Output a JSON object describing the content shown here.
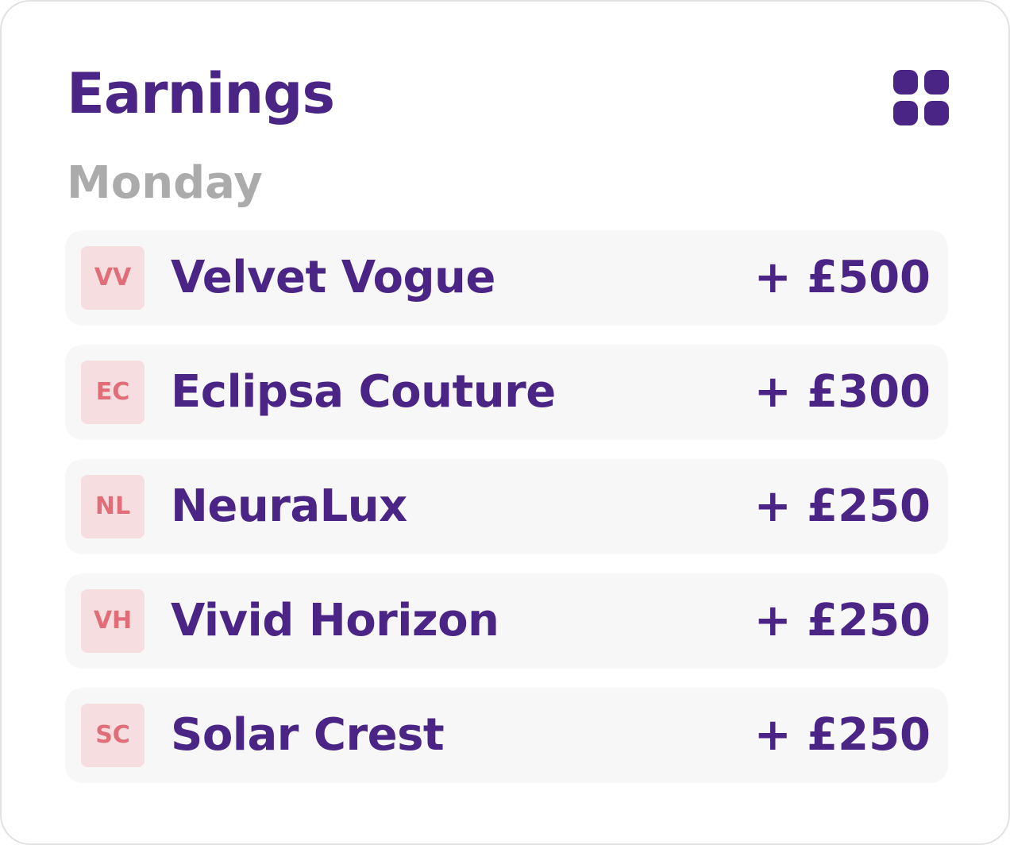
{
  "header": {
    "title": "Earnings",
    "menu_icon": "grid-icon"
  },
  "section": {
    "day_label": "Monday"
  },
  "earnings": [
    {
      "initials": "VV",
      "name": "Velvet Vogue",
      "amount": "+ £500"
    },
    {
      "initials": "EC",
      "name": "Eclipsa Couture",
      "amount": "+ £300"
    },
    {
      "initials": "NL",
      "name": "NeuraLux",
      "amount": "+ £250"
    },
    {
      "initials": "VH",
      "name": "Vivid Horizon",
      "amount": "+ £250"
    },
    {
      "initials": "SC",
      "name": "Solar Crest",
      "amount": "+ £250"
    }
  ],
  "colors": {
    "primary": "#4b2585",
    "muted_text": "#ababab",
    "row_background": "#f7f7f7",
    "badge_background": "#f6dddf",
    "badge_text": "#e16d78"
  }
}
